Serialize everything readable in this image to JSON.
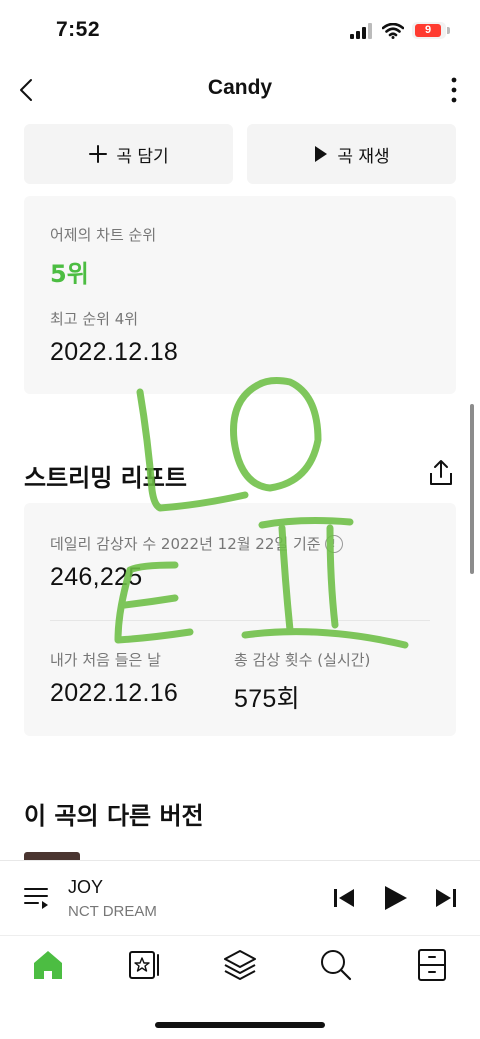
{
  "status": {
    "time": "7:52",
    "battery": "9"
  },
  "nav": {
    "title": "Candy"
  },
  "actions": {
    "add_label": "곡 담기",
    "play_label": "곡 재생"
  },
  "chart": {
    "yesterday_label": "어제의 차트 순위",
    "yesterday_rank": "5위",
    "best_label": "최고 순위 4위",
    "best_date": "2022.12.18"
  },
  "report": {
    "title": "스트리밍 리포트",
    "daily_label": "데일리 감상자 수 2022년 12월 22일 기준",
    "daily_value": "246,225",
    "first_listen_label": "내가 처음 들은 날",
    "first_listen_date": "2022.12.16",
    "total_plays_label": "총 감상 횟수 (실시간)",
    "total_plays_value": "575회"
  },
  "other_versions": {
    "title": "이 곡의 다른 버전"
  },
  "player": {
    "song": "JOY",
    "artist": "NCT DREAM"
  },
  "colors": {
    "accent": "#4cbd42",
    "scribble": "#6dbf45"
  },
  "icons": {
    "tabs": [
      "home-icon",
      "library-icon",
      "layers-icon",
      "search-icon",
      "drawer-icon"
    ]
  }
}
